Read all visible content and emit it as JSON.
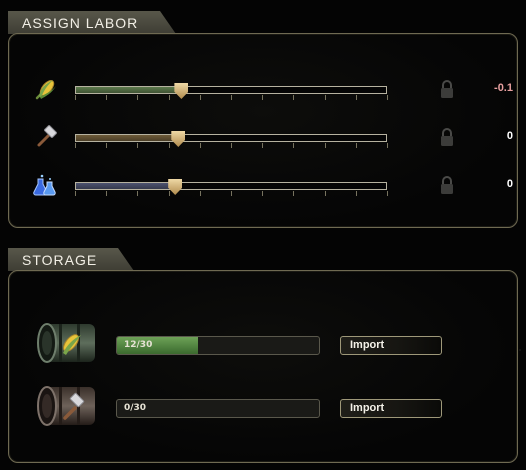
{
  "labor": {
    "title": "Assign Labor",
    "rows": [
      {
        "resource": "food",
        "icon": "corn-icon",
        "slider_fraction": 0.34,
        "fill_color": "#5d7a4c",
        "value": "-0.1",
        "value_color": "#e8a0a0",
        "lock_icon": "lock-icon"
      },
      {
        "resource": "production",
        "icon": "hammer-icon",
        "slider_fraction": 0.33,
        "fill_color": "#6e5b38",
        "value": "0",
        "value_color": "#ffffff",
        "lock_icon": "lock-icon"
      },
      {
        "resource": "science",
        "icon": "flask-icon",
        "slider_fraction": 0.32,
        "fill_color": "#4d5370",
        "value": "0",
        "value_color": "#ffffff",
        "lock_icon": "lock-icon"
      }
    ]
  },
  "storage": {
    "title": "Storage",
    "rows": [
      {
        "resource": "food",
        "icon": "corn-barrel-icon",
        "amount": "12/30",
        "fill_fraction": 0.4,
        "import_label": "Import"
      },
      {
        "resource": "production",
        "icon": "hammer-barrel-icon",
        "amount": "0/30",
        "fill_fraction": 0,
        "import_label": "Import"
      }
    ]
  }
}
